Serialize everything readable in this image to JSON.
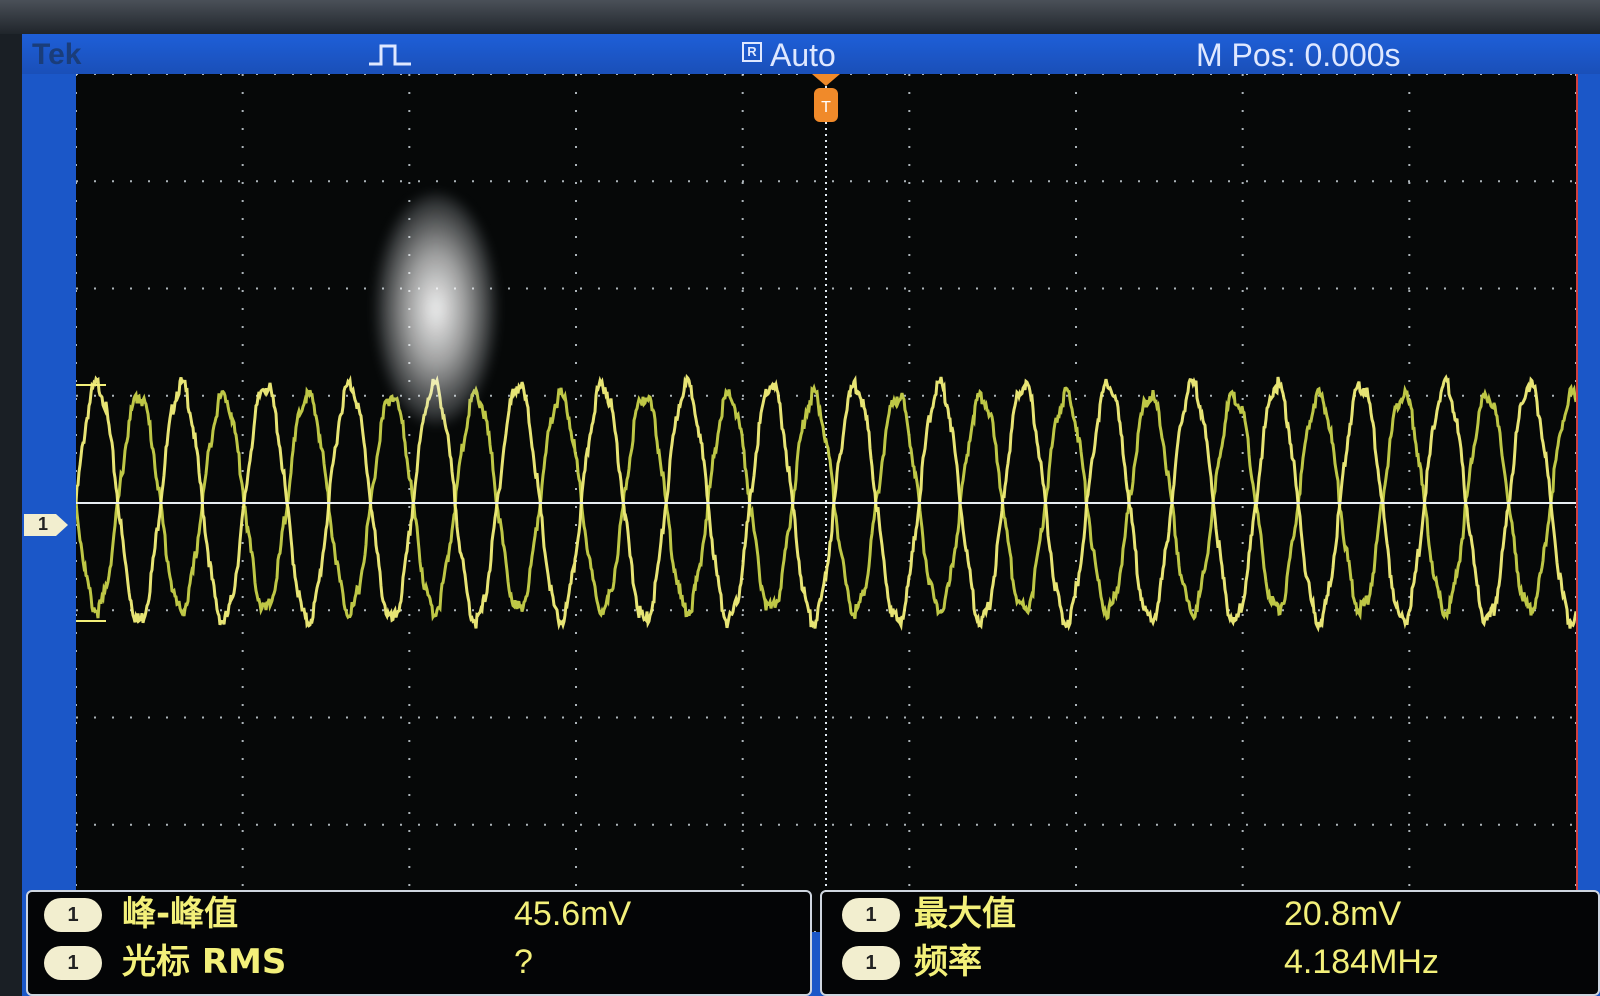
{
  "header": {
    "brand": "Tek",
    "acquisition_mode": "Auto",
    "run_state_icon": "R",
    "main_position": "M Pos: 0.000s"
  },
  "channel_marker": "1",
  "colors": {
    "header": "#1b57c8",
    "trace_ch1": "#f3f07a",
    "trace_ch2": "#c8d24a",
    "grid": "#c9d2d8",
    "trigger": "#f08a2a"
  },
  "icons": {
    "trigger_type": "rising-pulse-icon",
    "trigger_position": "trigger-position-icon",
    "run_state": "run-state-icon"
  },
  "measurements": {
    "left": [
      {
        "channel": "1",
        "label": "峰-峰值",
        "value": "45.6mV"
      },
      {
        "channel": "1",
        "label": "光标 RMS",
        "value": "?"
      }
    ],
    "right": [
      {
        "channel": "1",
        "label": "最大值",
        "value": "20.8mV"
      },
      {
        "channel": "1",
        "label": "频率",
        "value": "4.184MHz"
      }
    ]
  },
  "chart_data": {
    "type": "line",
    "title": "",
    "xlabel": "",
    "ylabel": "",
    "grid": true,
    "x_divisions": 9,
    "y_divisions": 8,
    "xlim": [
      -4.5,
      4.5
    ],
    "ylim": [
      -4,
      4
    ],
    "series": [
      {
        "x_cycles": 17.8,
        "amplitude_div": 1.1,
        "offset_div": 0,
        "phase_deg": 0
      },
      {
        "x_cycles": 17.8,
        "amplitude_div": 1.0,
        "offset_div": 0,
        "phase_deg": 180
      }
    ]
  }
}
